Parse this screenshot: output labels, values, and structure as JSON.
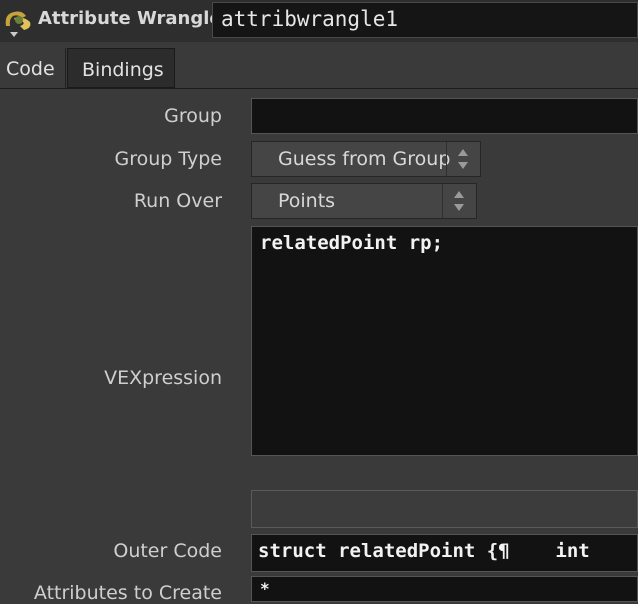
{
  "header": {
    "node_type": "Attribute Wrangle",
    "node_name": "attribwrangle1"
  },
  "tabs": [
    {
      "label": "Code"
    },
    {
      "label": "Bindings"
    }
  ],
  "params": {
    "group": {
      "label": "Group",
      "value": ""
    },
    "group_type": {
      "label": "Group Type",
      "value": "Guess from Group"
    },
    "run_over": {
      "label": "Run Over",
      "value": "Points"
    },
    "vexpression": {
      "label": "VEXpression",
      "value": "relatedPoint rp;"
    },
    "outer_code": {
      "label": "Outer Code",
      "value": "struct relatedPoint {¶    int"
    },
    "attributes_to_create": {
      "label": "Attributes to Create",
      "value": "*"
    }
  },
  "colors": {
    "background": "#3a3a3a",
    "field": "#121212",
    "header": "#2e2e2e"
  }
}
